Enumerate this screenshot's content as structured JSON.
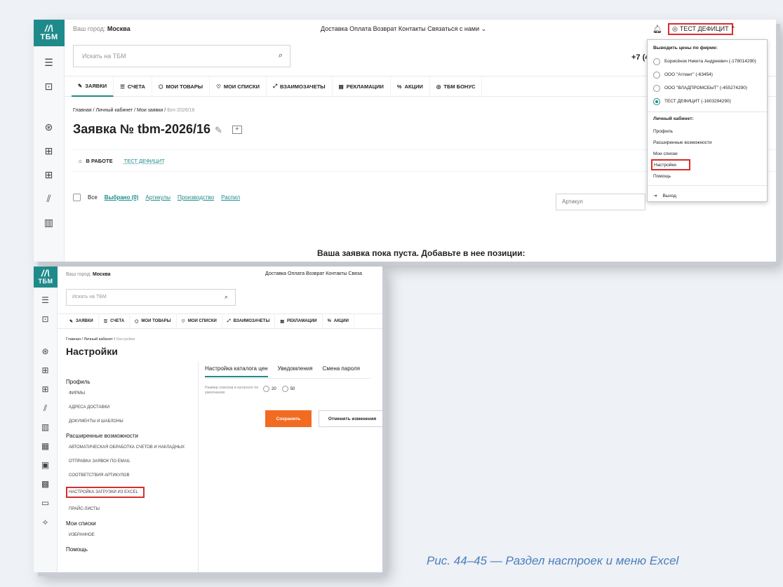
{
  "brand": {
    "mark": "//\\",
    "name": "ТБМ"
  },
  "top": {
    "city_label": "Ваш город:",
    "city": "Москва",
    "nav": "Доставка  Оплата  Возврат  Контакты  Связаться с нами ⌄",
    "nav_short": "Доставка  Оплата  Возврат  Контакты  Связа",
    "search_placeholder": "Искать на ТБМ",
    "phone": "+7 (4",
    "user": "ТЕСТ ДЕФИЦИТ ⌃"
  },
  "tabs": [
    "ЗАЯВКИ",
    "СЧЕТА",
    "МОИ ТОВАРЫ",
    "МОИ СПИСКИ",
    "ВЗАИМОЗАЧЕТЫ",
    "РЕКЛАМАЦИИ",
    "АКЦИИ",
    "ТБМ БОНУС"
  ],
  "shot1": {
    "crumb": [
      "Главная",
      "Личный кабинет",
      "Мои заявки",
      "tbm-2026/16"
    ],
    "title": "Заявка № tbm-2026/16",
    "status": "В РАБОТЕ",
    "firm": "ТЕСТ ДЕФИЦИТ",
    "all": "Все",
    "selected": "Выбрано (0)",
    "filters": [
      "Артикулы",
      "Производство",
      "Распил"
    ],
    "article_placeholder": "Артикул",
    "empty": "Ваша заявка пока пуста. Добавьте в нее позиции:"
  },
  "dropdown": {
    "price_header": "Выводить цены по фирме:",
    "firms": [
      "Борисёнок Никита Андреевич (-178014290)",
      "ООО \"Атлант\" (-63454)",
      "ООО \"ВЛАДПРОМСБЫТ\" (-455274290)",
      "ТЕСТ ДЕФИЦИТ (-1603294290)"
    ],
    "selected_index": 3,
    "cabinet_header": "Личный кабинет:",
    "menu": [
      "Профиль",
      "Расширенные возможности",
      "Мои списки",
      "Настройки",
      "Помощь"
    ],
    "exit": "Выход"
  },
  "shot2": {
    "crumb": [
      "Главная",
      "Личный кабинет",
      "Настройки"
    ],
    "title": "Настройки",
    "sections": [
      {
        "title": "Профиль",
        "items": [
          "ФИРМЫ",
          "АДРЕСА ДОСТАВКИ",
          "ДОКУМЕНТЫ И ШАБЛОНЫ"
        ]
      },
      {
        "title": "Расширенные возможности",
        "items": [
          "АВТОМАТИЧЕСКАЯ ОБРАБОТКА СЧЕТОВ И НАКЛАДНЫХ",
          "ОТПРАВКА ЗАЯВОК ПО EMAIL",
          "СООТВЕТСТВИЯ АРТИКУЛОВ",
          "НАСТРОЙКА ЗАГРУЗКИ ИЗ EXCEL",
          "ПРАЙС-ЛИСТЫ"
        ]
      },
      {
        "title": "Мои списки",
        "items": [
          "ИЗБРАННОЕ"
        ]
      },
      {
        "title": "Помощь",
        "items": []
      }
    ],
    "settings_tabs": [
      "Настройка каталога цен",
      "Уведомления",
      "Смена пароля"
    ],
    "page_size_label": "Размер списков в каталоге по умолчанию",
    "page_sizes": [
      "20",
      "50"
    ],
    "save": "Сохранить",
    "cancel": "Отменить изменения"
  },
  "caption": "Рис. 44–45 — Раздел настроек и меню Excel"
}
